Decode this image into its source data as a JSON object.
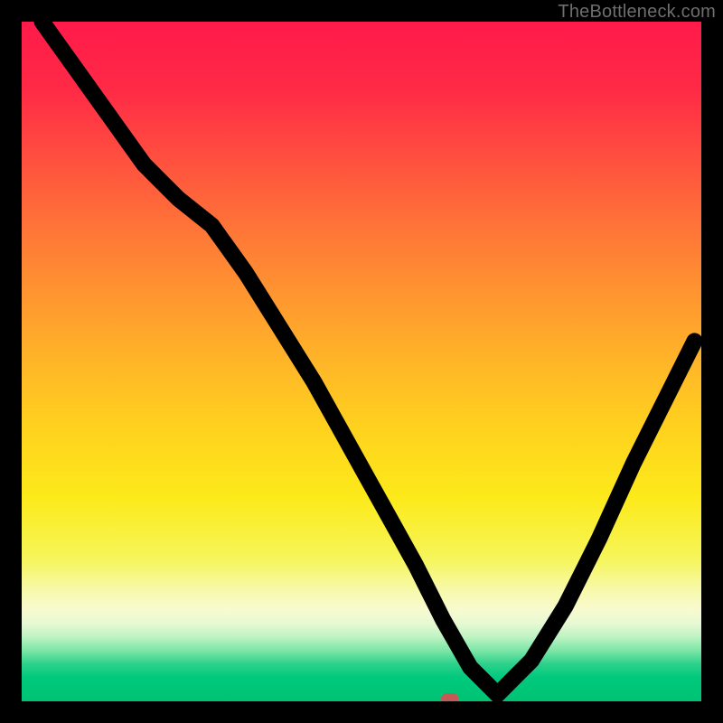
{
  "watermark": "TheBottleneck.com",
  "colors": {
    "black": "#000000",
    "curve": "#000000",
    "marker": "#c25b55",
    "gradient_stops": [
      {
        "offset": 0.0,
        "color": "#ff1a4a"
      },
      {
        "offset": 0.1,
        "color": "#ff2a46"
      },
      {
        "offset": 0.2,
        "color": "#ff4f3f"
      },
      {
        "offset": 0.3,
        "color": "#ff7338"
      },
      {
        "offset": 0.4,
        "color": "#ff9530"
      },
      {
        "offset": 0.5,
        "color": "#ffb528"
      },
      {
        "offset": 0.6,
        "color": "#ffd21e"
      },
      {
        "offset": 0.7,
        "color": "#fcea1a"
      },
      {
        "offset": 0.79,
        "color": "#f6f55a"
      },
      {
        "offset": 0.835,
        "color": "#f7f9a8"
      },
      {
        "offset": 0.865,
        "color": "#f8fad0"
      },
      {
        "offset": 0.885,
        "color": "#e7f9d3"
      },
      {
        "offset": 0.905,
        "color": "#bff3c4"
      },
      {
        "offset": 0.925,
        "color": "#7de6a7"
      },
      {
        "offset": 0.945,
        "color": "#2dd18b"
      },
      {
        "offset": 0.965,
        "color": "#00c97d"
      },
      {
        "offset": 1.0,
        "color": "#00c373"
      }
    ]
  },
  "chart_data": {
    "type": "line",
    "title": "",
    "xlabel": "",
    "ylabel": "",
    "xlim": [
      0,
      100
    ],
    "ylim": [
      0,
      100
    ],
    "x": [
      3,
      8,
      13,
      18,
      23,
      28,
      33,
      38,
      43,
      48,
      53,
      58,
      62,
      66,
      70,
      75,
      80,
      85,
      90,
      95,
      99
    ],
    "values": [
      100,
      93,
      86,
      79,
      74,
      70,
      63,
      55,
      47,
      38,
      29,
      20,
      12,
      5,
      1,
      6,
      14,
      24,
      35,
      45,
      53
    ],
    "flat_bottom_x_range": [
      58,
      66
    ],
    "marker": {
      "x": 63,
      "y": 0
    },
    "annotations": []
  }
}
